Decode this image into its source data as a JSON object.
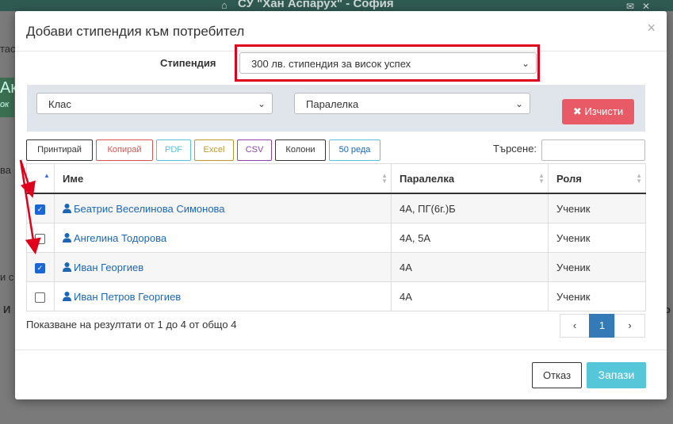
{
  "background": {
    "school_title": "СУ \"Хан Аспарух\" - София",
    "fragments": [
      "тас",
      "Ак",
      "ок",
      "ва",
      "и с",
      "И",
      "о"
    ]
  },
  "modal": {
    "title": "Добави стипендия към потребител",
    "close": "×",
    "scholarship_label": "Стипендия",
    "scholarship_value": "300 лв. стипендия за висок успех",
    "class_placeholder": "Клас",
    "section_placeholder": "Паралелка",
    "clear_button": "Изчисти",
    "toolbar": {
      "print": "Принтирай",
      "copy": "Копирай",
      "pdf": "PDF",
      "excel": "Excel",
      "csv": "CSV",
      "columns": "Колони",
      "rows": "50 реда"
    },
    "search_label": "Търсене:",
    "columns": [
      "Име",
      "Паралелка",
      "Роля"
    ],
    "rows": [
      {
        "checked": true,
        "name": "Беатрис Веселинова Симонова",
        "section": "4А, ПГ(6г.)Б",
        "role": "Ученик"
      },
      {
        "checked": false,
        "name": "Ангелина Тодорова",
        "section": "4А, 5А",
        "role": "Ученик"
      },
      {
        "checked": true,
        "name": "Иван Георгиев",
        "section": "4А",
        "role": "Ученик"
      },
      {
        "checked": false,
        "name": "Иван Петров Георгиев",
        "section": "4А",
        "role": "Ученик"
      }
    ],
    "info": "Показване на резултати от 1 до 4 от общо 4",
    "pagination": {
      "prev": "‹",
      "page": "1",
      "next": "›"
    },
    "cancel_button": "Отказ",
    "save_button": "Запази"
  },
  "colors": {
    "accent": "#55c7d9",
    "danger": "#e85a65",
    "link": "#1c66b6",
    "highlight": "#e0001b",
    "page_active": "#337ab7"
  }
}
